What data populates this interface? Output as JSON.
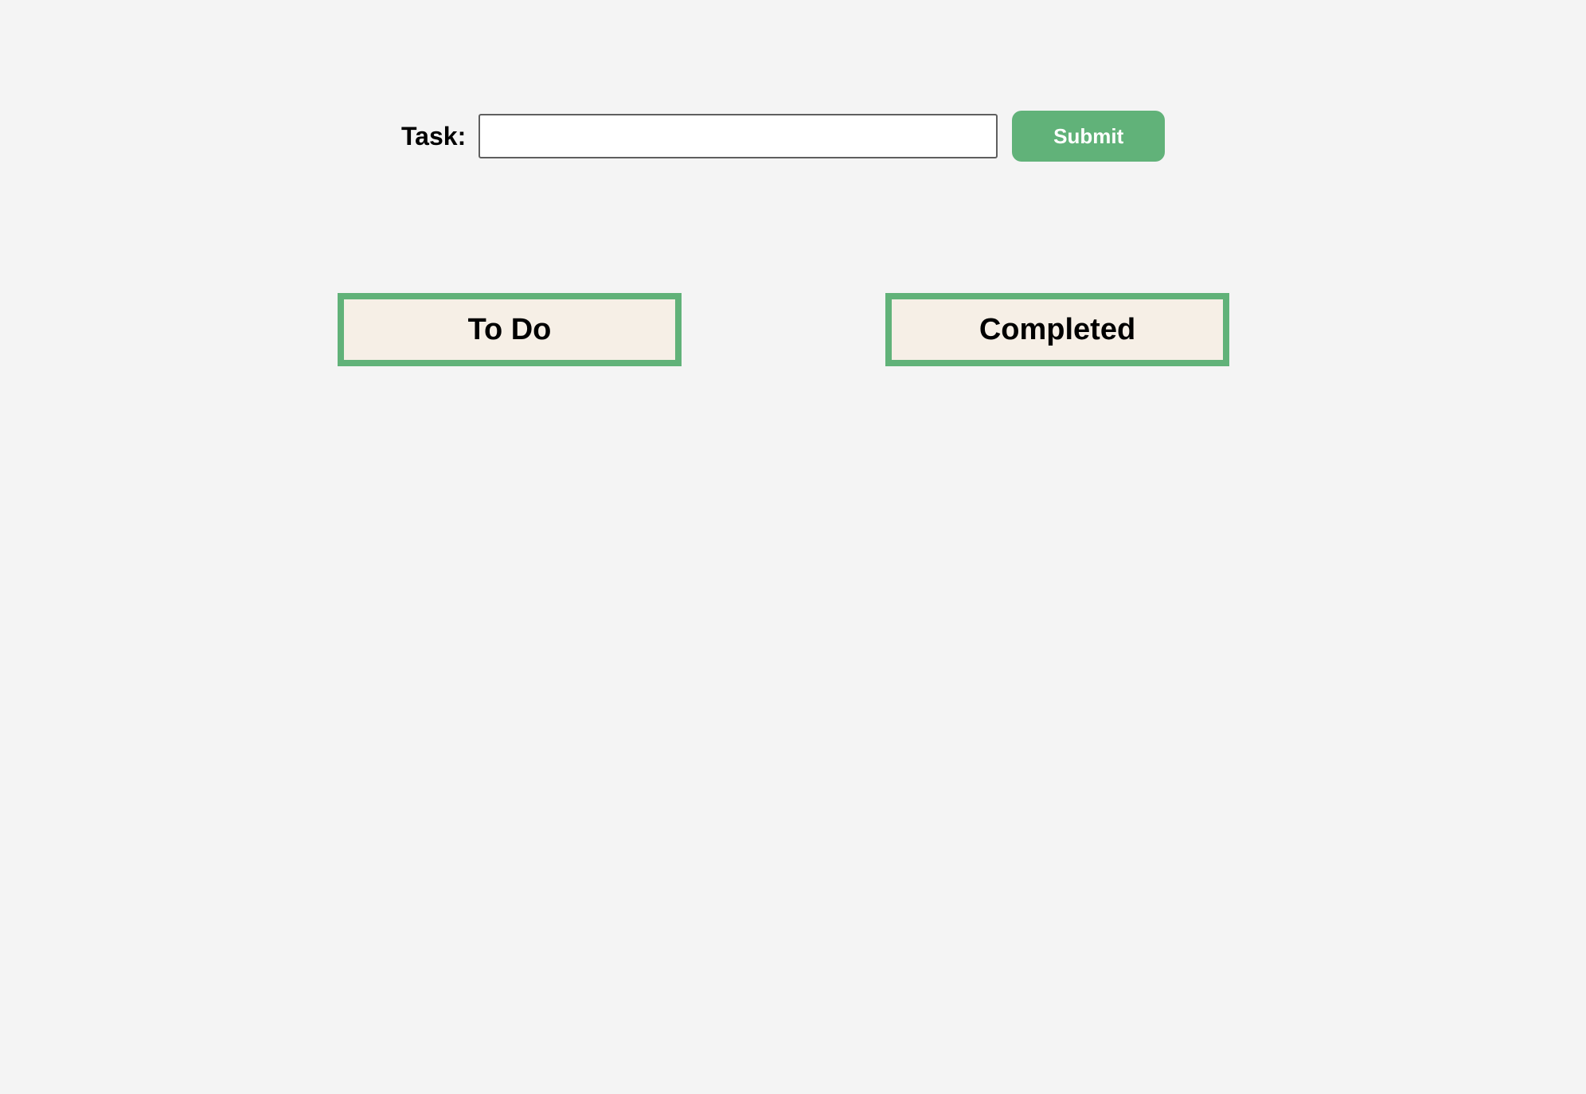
{
  "task_form": {
    "label": "Task:",
    "input_value": "",
    "input_placeholder": "",
    "submit_label": "Submit"
  },
  "columns": [
    {
      "title": "To Do",
      "items": []
    },
    {
      "title": "Completed",
      "items": []
    }
  ],
  "colors": {
    "background": "#f4f4f4",
    "accent": "#61b279",
    "column_fill": "#f6efe6"
  }
}
